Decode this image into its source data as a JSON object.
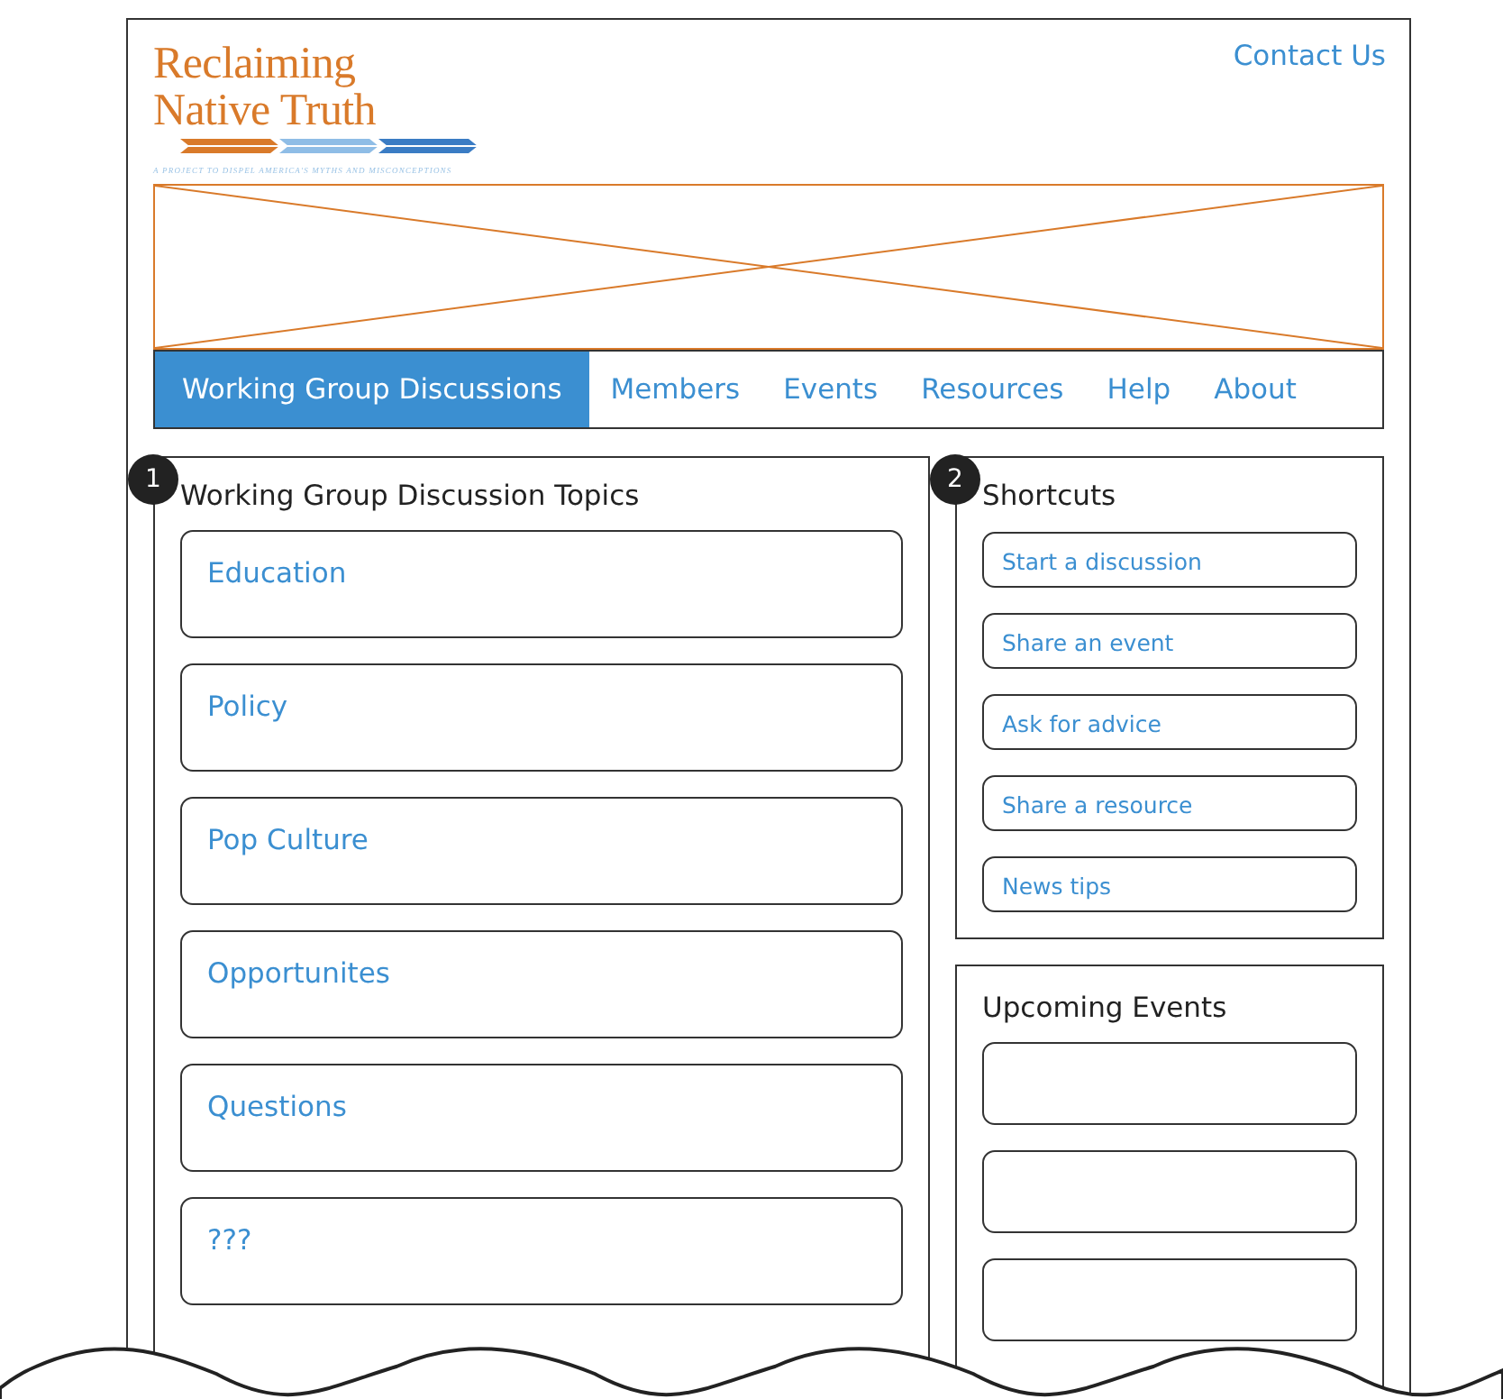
{
  "logo": {
    "title_line_1": "Reclaiming",
    "title_line_2": "Native Truth",
    "tagline": "A PROJECT TO DISPEL AMERICA'S MYTHS AND MISCONCEPTIONS"
  },
  "contact_link": "Contact Us",
  "banner": {
    "kind": "placeholder"
  },
  "nav": [
    {
      "label": "Working Group Discussions",
      "selected": true
    },
    {
      "label": "Members",
      "selected": false
    },
    {
      "label": "Events",
      "selected": false
    },
    {
      "label": "Resources",
      "selected": false
    },
    {
      "label": "Help",
      "selected": false
    },
    {
      "label": "About",
      "selected": false
    }
  ],
  "topics_panel": {
    "marker": "1",
    "title": "Working Group Discussion Topics",
    "topics": [
      {
        "kind": "topic",
        "label": "Education"
      },
      {
        "kind": "topic",
        "label": "Policy"
      },
      {
        "kind": "topic",
        "label": "Pop Culture"
      },
      {
        "kind": "topic",
        "label": "Opportunites"
      },
      {
        "kind": "topic",
        "label": "Questions"
      },
      {
        "kind": "topic",
        "label": "???"
      }
    ]
  },
  "shortcuts_panel": {
    "marker": "2",
    "title": "Shortcuts",
    "links": [
      "Start a discussion",
      "Share an event",
      "Ask for advice",
      "Share a resource",
      "News tips"
    ]
  },
  "events_panel": {
    "title": "Upcoming Events",
    "events": [
      {
        "kind": "empty"
      },
      {
        "kind": "empty"
      },
      {
        "kind": "empty"
      }
    ]
  }
}
